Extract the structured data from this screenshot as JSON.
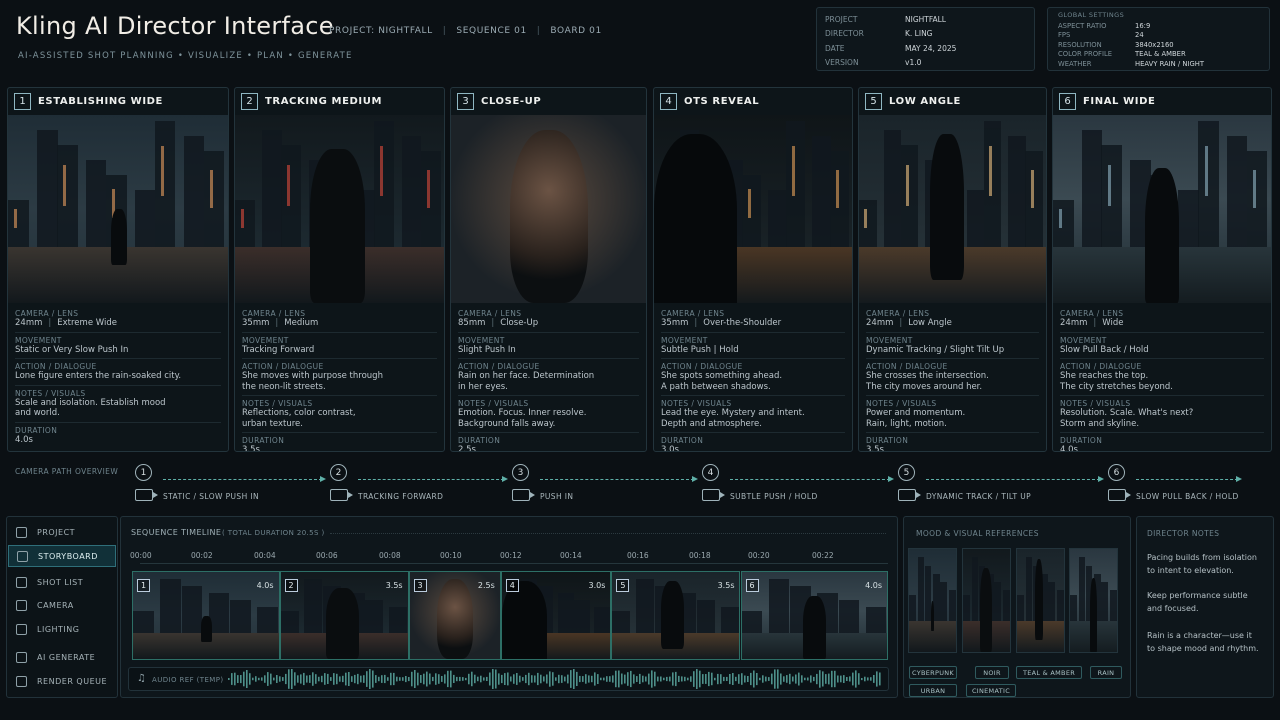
{
  "header": {
    "title": "Kling AI Director Interface",
    "breadcrumbs": [
      "PROJECT: NIGHTFALL",
      "SEQUENCE 01",
      "BOARD 01"
    ],
    "subtitle": "AI-ASSISTED SHOT PLANNING  •  VISUALIZE  •  PLAN  •  GENERATE"
  },
  "project_info": [
    {
      "k": "PROJECT",
      "v": "NIGHTFALL"
    },
    {
      "k": "DIRECTOR",
      "v": "K. LING"
    },
    {
      "k": "DATE",
      "v": "MAY 24, 2025"
    },
    {
      "k": "VERSION",
      "v": "v1.0"
    }
  ],
  "global_settings": {
    "title": "GLOBAL SETTINGS",
    "rows": [
      {
        "k": "ASPECT RATIO",
        "v": "16:9"
      },
      {
        "k": "FPS",
        "v": "24"
      },
      {
        "k": "RESOLUTION",
        "v": "3840x2160"
      },
      {
        "k": "COLOR PROFILE",
        "v": "TEAL & AMBER"
      },
      {
        "k": "WEATHER",
        "v": "HEAVY RAIN / NIGHT"
      }
    ]
  },
  "field_labels": {
    "camera": "CAMERA / LENS",
    "movement": "MOVEMENT",
    "action": "ACTION / DIALOGUE",
    "notes": "NOTES / VISUALS",
    "duration": "DURATION"
  },
  "shots": [
    {
      "num": "1",
      "title": "ESTABLISHING WIDE",
      "lens": "24mm",
      "framing": "Extreme Wide",
      "movement": "Static or Very Slow Push In",
      "action": [
        "Lone figure enters the rain-soaked city.",
        ""
      ],
      "notes": [
        "Scale and isolation. Establish mood",
        "and world."
      ],
      "duration": "4.0s"
    },
    {
      "num": "2",
      "title": "TRACKING MEDIUM",
      "lens": "35mm",
      "framing": "Medium",
      "movement": "Tracking Forward",
      "action": [
        "She moves with purpose through",
        "the neon-lit streets."
      ],
      "notes": [
        "Reflections, color contrast,",
        "urban texture."
      ],
      "duration": "3.5s"
    },
    {
      "num": "3",
      "title": "CLOSE-UP",
      "lens": "85mm",
      "framing": "Close-Up",
      "movement": "Slight Push In",
      "action": [
        "Rain on her face. Determination",
        "in her eyes."
      ],
      "notes": [
        "Emotion. Focus. Inner resolve.",
        "Background falls away."
      ],
      "duration": "2.5s"
    },
    {
      "num": "4",
      "title": "OTS REVEAL",
      "lens": "35mm",
      "framing": "Over-the-Shoulder",
      "movement": "Subtle Push | Hold",
      "action": [
        "She spots something ahead.",
        "A path between shadows."
      ],
      "notes": [
        "Lead the eye. Mystery and intent.",
        "Depth and atmosphere."
      ],
      "duration": "3.0s"
    },
    {
      "num": "5",
      "title": "LOW ANGLE",
      "lens": "24mm",
      "framing": "Low Angle",
      "movement": "Dynamic Tracking / Slight Tilt Up",
      "action": [
        "She crosses the intersection.",
        "The city moves around her."
      ],
      "notes": [
        "Power and momentum.",
        "Rain, light, motion."
      ],
      "duration": "3.5s"
    },
    {
      "num": "6",
      "title": "FINAL WIDE",
      "lens": "24mm",
      "framing": "Wide",
      "movement": "Slow Pull Back / Hold",
      "action": [
        "She reaches the top.",
        "The city stretches beyond."
      ],
      "notes": [
        "Resolution. Scale. What's next?",
        "Storm and skyline."
      ],
      "duration": "4.0s"
    }
  ],
  "camera_path": {
    "title": "CAMERA PATH OVERVIEW",
    "steps": [
      {
        "num": "1",
        "label": "STATIC / SLOW PUSH IN"
      },
      {
        "num": "2",
        "label": "TRACKING FORWARD"
      },
      {
        "num": "3",
        "label": "PUSH IN"
      },
      {
        "num": "4",
        "label": "SUBTLE PUSH / HOLD"
      },
      {
        "num": "5",
        "label": "DYNAMIC TRACK / TILT UP"
      },
      {
        "num": "6",
        "label": "SLOW PULL BACK / HOLD"
      }
    ]
  },
  "sidebar": {
    "items": [
      {
        "label": "PROJECT",
        "icon": "folder-icon",
        "active": false
      },
      {
        "label": "STORYBOARD",
        "icon": "storyboard-icon",
        "active": true
      },
      {
        "label": "SHOT LIST",
        "icon": "list-icon",
        "active": false
      },
      {
        "label": "CAMERA",
        "icon": "camera-icon",
        "active": false
      },
      {
        "label": "LIGHTING",
        "icon": "sun-icon",
        "active": false
      },
      {
        "label": "AI GENERATE",
        "icon": "sparkle-icon",
        "active": false
      },
      {
        "label": "RENDER QUEUE",
        "icon": "queue-icon",
        "active": false
      }
    ]
  },
  "timeline": {
    "title": "SEQUENCE TIMELINE",
    "total": "( TOTAL DURATION  20.5s )",
    "ticks": [
      "00:00",
      "00:02",
      "00:04",
      "00:06",
      "00:08",
      "00:10",
      "00:12",
      "00:14",
      "00:16",
      "00:18",
      "00:20",
      "00:22"
    ],
    "clips": [
      {
        "num": "1",
        "duration": "4.0s",
        "seconds": 4.0
      },
      {
        "num": "2",
        "duration": "3.5s",
        "seconds": 3.5
      },
      {
        "num": "3",
        "duration": "2.5s",
        "seconds": 2.5
      },
      {
        "num": "4",
        "duration": "3.0s",
        "seconds": 3.0
      },
      {
        "num": "5",
        "duration": "3.5s",
        "seconds": 3.5
      },
      {
        "num": "6",
        "duration": "4.0s",
        "seconds": 4.0
      }
    ],
    "audio": "AUDIO REF (TEMP)"
  },
  "mood": {
    "title": "MOOD & VISUAL REFERENCES",
    "tags": [
      "CYBERPUNK",
      "NOIR",
      "TEAL & AMBER",
      "RAIN",
      "URBAN",
      "CINEMATIC"
    ]
  },
  "director_notes": {
    "title": "DIRECTOR NOTES",
    "notes": [
      [
        "Pacing builds from isolation",
        "to intent to elevation."
      ],
      [
        "Keep performance subtle",
        "and focused."
      ],
      [
        "Rain is a character—use it",
        "to shape mood and rhythm."
      ]
    ]
  },
  "colors": {
    "accent": "#2f6f7a",
    "teal": "#5fb0a8",
    "amber": "#e8a25a",
    "bg": "#0b1014"
  }
}
